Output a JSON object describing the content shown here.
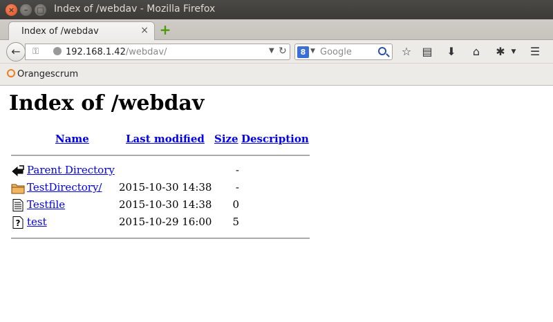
{
  "window": {
    "title": "Index of /webdav - Mozilla Firefox",
    "close_glyph": "×",
    "min_glyph": "–",
    "max_glyph": "□"
  },
  "tab": {
    "label": "Index of /webdav",
    "close_glyph": "×",
    "new_tab_glyph": "+"
  },
  "nav": {
    "back_glyph": "←",
    "url_host": "192.168.1.42",
    "url_path": "/webdav/",
    "search_engine_glyph": "8",
    "search_placeholder": "Google",
    "icons": [
      "star-icon",
      "reading-list-icon",
      "download-icon",
      "home-icon",
      "addon-icon",
      "menu-icon"
    ],
    "star_glyph": "☆",
    "list_glyph": "▤",
    "download_glyph": "⬇",
    "home_glyph": "⌂",
    "addon_glyph": "✱",
    "menu_glyph": "☰"
  },
  "bookmarks": {
    "items": [
      {
        "label": "Orangescrum",
        "color": "#f07c1a"
      }
    ]
  },
  "page": {
    "heading": "Index of /webdav",
    "columns": {
      "name": "Name",
      "last_modified": "Last modified",
      "size": "Size",
      "description": "Description"
    },
    "rows": [
      {
        "icon": "parent-directory-icon",
        "name": "Parent Directory",
        "modified": "",
        "size": "-",
        "description": ""
      },
      {
        "icon": "folder-icon",
        "name": "TestDirectory/",
        "modified": "2015-10-30 14:38",
        "size": "-",
        "description": ""
      },
      {
        "icon": "text-file-icon",
        "name": "Testfile",
        "modified": "2015-10-30 14:38",
        "size": "0",
        "description": ""
      },
      {
        "icon": "unknown-file-icon",
        "name": "test",
        "modified": "2015-10-29 16:00",
        "size": "5",
        "description": ""
      }
    ],
    "link_color": "#0000ee"
  }
}
